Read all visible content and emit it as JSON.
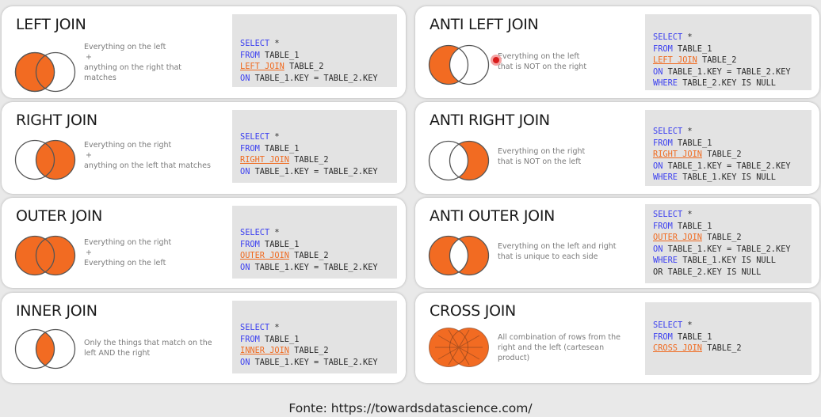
{
  "cards": [
    {
      "title": "LEFT JOIN",
      "desc": [
        "Everything on the left",
        "+",
        "anything on the right that",
        "matches"
      ],
      "code": [
        [
          [
            "kw",
            "SELECT"
          ],
          [
            "t",
            " *"
          ]
        ],
        [
          [
            "kw",
            "FROM"
          ],
          [
            "t",
            " TABLE_1"
          ]
        ],
        [
          [
            "jn",
            "LEFT JOIN"
          ],
          [
            "t",
            " TABLE_2"
          ]
        ],
        [
          [
            "kw",
            "ON"
          ],
          [
            "t",
            " TABLE_1.KEY = TABLE_2.KEY"
          ]
        ]
      ]
    },
    {
      "title": "ANTI LEFT JOIN",
      "desc": [
        "Everything on the left",
        "that is NOT on the right"
      ],
      "code": [
        [
          [
            "kw",
            "SELECT"
          ],
          [
            "t",
            " *"
          ]
        ],
        [
          [
            "kw",
            "FROM"
          ],
          [
            "t",
            " TABLE_1"
          ]
        ],
        [
          [
            "jn",
            "LEFT JOIN"
          ],
          [
            "t",
            " TABLE_2"
          ]
        ],
        [
          [
            "kw",
            "ON"
          ],
          [
            "t",
            " TABLE_1.KEY = TABLE_2.KEY"
          ]
        ],
        [
          [
            "kw",
            "WHERE"
          ],
          [
            "t",
            " TABLE_2.KEY IS NULL"
          ]
        ]
      ]
    },
    {
      "title": "RIGHT JOIN",
      "desc": [
        "Everything on the right",
        "+",
        "anything on the left that matches"
      ],
      "code": [
        [
          [
            "kw",
            "SELECT"
          ],
          [
            "t",
            " *"
          ]
        ],
        [
          [
            "kw",
            "FROM"
          ],
          [
            "t",
            " TABLE_1"
          ]
        ],
        [
          [
            "jn",
            "RIGHT JOIN"
          ],
          [
            "t",
            " TABLE_2"
          ]
        ],
        [
          [
            "kw",
            "ON"
          ],
          [
            "t",
            " TABLE_1.KEY = TABLE_2.KEY"
          ]
        ]
      ]
    },
    {
      "title": "ANTI RIGHT JOIN",
      "desc": [
        "Everything on the right",
        "that is NOT on the left"
      ],
      "code": [
        [
          [
            "kw",
            "SELECT"
          ],
          [
            "t",
            " *"
          ]
        ],
        [
          [
            "kw",
            "FROM"
          ],
          [
            "t",
            " TABLE_1"
          ]
        ],
        [
          [
            "jn",
            "RIGHT JOIN"
          ],
          [
            "t",
            " TABLE_2"
          ]
        ],
        [
          [
            "kw",
            "ON"
          ],
          [
            "t",
            " TABLE_1.KEY = TABLE_2.KEY"
          ]
        ],
        [
          [
            "kw",
            "WHERE"
          ],
          [
            "t",
            " TABLE_1.KEY IS NULL"
          ]
        ]
      ]
    },
    {
      "title": "OUTER JOIN",
      "desc": [
        "Everything on the right",
        "+",
        "Everything on the left"
      ],
      "code": [
        [
          [
            "kw",
            "SELECT"
          ],
          [
            "t",
            " *"
          ]
        ],
        [
          [
            "kw",
            "FROM"
          ],
          [
            "t",
            " TABLE_1"
          ]
        ],
        [
          [
            "jn",
            "OUTER JOIN"
          ],
          [
            "t",
            " TABLE_2"
          ]
        ],
        [
          [
            "kw",
            "ON"
          ],
          [
            "t",
            " TABLE_1.KEY = TABLE_2.KEY"
          ]
        ]
      ]
    },
    {
      "title": "ANTI OUTER JOIN",
      "desc": [
        "Everything on the left and right",
        "that is unique to each side"
      ],
      "code": [
        [
          [
            "kw",
            "SELECT"
          ],
          [
            "t",
            " *"
          ]
        ],
        [
          [
            "kw",
            "FROM"
          ],
          [
            "t",
            " TABLE_1"
          ]
        ],
        [
          [
            "jn",
            "OUTER JOIN"
          ],
          [
            "t",
            " TABLE_2"
          ]
        ],
        [
          [
            "kw",
            "ON"
          ],
          [
            "t",
            " TABLE_1.KEY = TABLE_2.KEY"
          ]
        ],
        [
          [
            "kw",
            "WHERE"
          ],
          [
            "t",
            " TABLE_1.KEY IS NULL"
          ]
        ],
        [
          [
            "t",
            "OR TABLE_2.KEY IS NULL"
          ]
        ]
      ]
    },
    {
      "title": "INNER JOIN",
      "desc": [
        "Only the things that match on the",
        "left AND the right"
      ],
      "code": [
        [
          [
            "kw",
            "SELECT"
          ],
          [
            "t",
            " *"
          ]
        ],
        [
          [
            "kw",
            "FROM"
          ],
          [
            "t",
            " TABLE_1"
          ]
        ],
        [
          [
            "jn",
            "INNER JOIN"
          ],
          [
            "t",
            " TABLE_2"
          ]
        ],
        [
          [
            "kw",
            "ON"
          ],
          [
            "t",
            " TABLE_1.KEY = TABLE_2.KEY"
          ]
        ]
      ]
    },
    {
      "title": "CROSS JOIN",
      "desc": [
        "All combination of rows from the",
        "right and the left (cartesean",
        "product)"
      ],
      "code": [
        [
          [
            "kw",
            "SELECT"
          ],
          [
            "t",
            " *"
          ]
        ],
        [
          [
            "kw",
            "FROM"
          ],
          [
            "t",
            " TABLE_1"
          ]
        ],
        [
          [
            "jn",
            "CROSS JOIN"
          ],
          [
            "t",
            " TABLE_2"
          ]
        ]
      ]
    }
  ],
  "footer": "Fonte: https://towardsdatascience.com/",
  "colors": {
    "accent": "#f06a1f",
    "keyword": "#3b3ff0",
    "code_bg": "#e3e3e3",
    "venn_fill": "#f26b22"
  }
}
